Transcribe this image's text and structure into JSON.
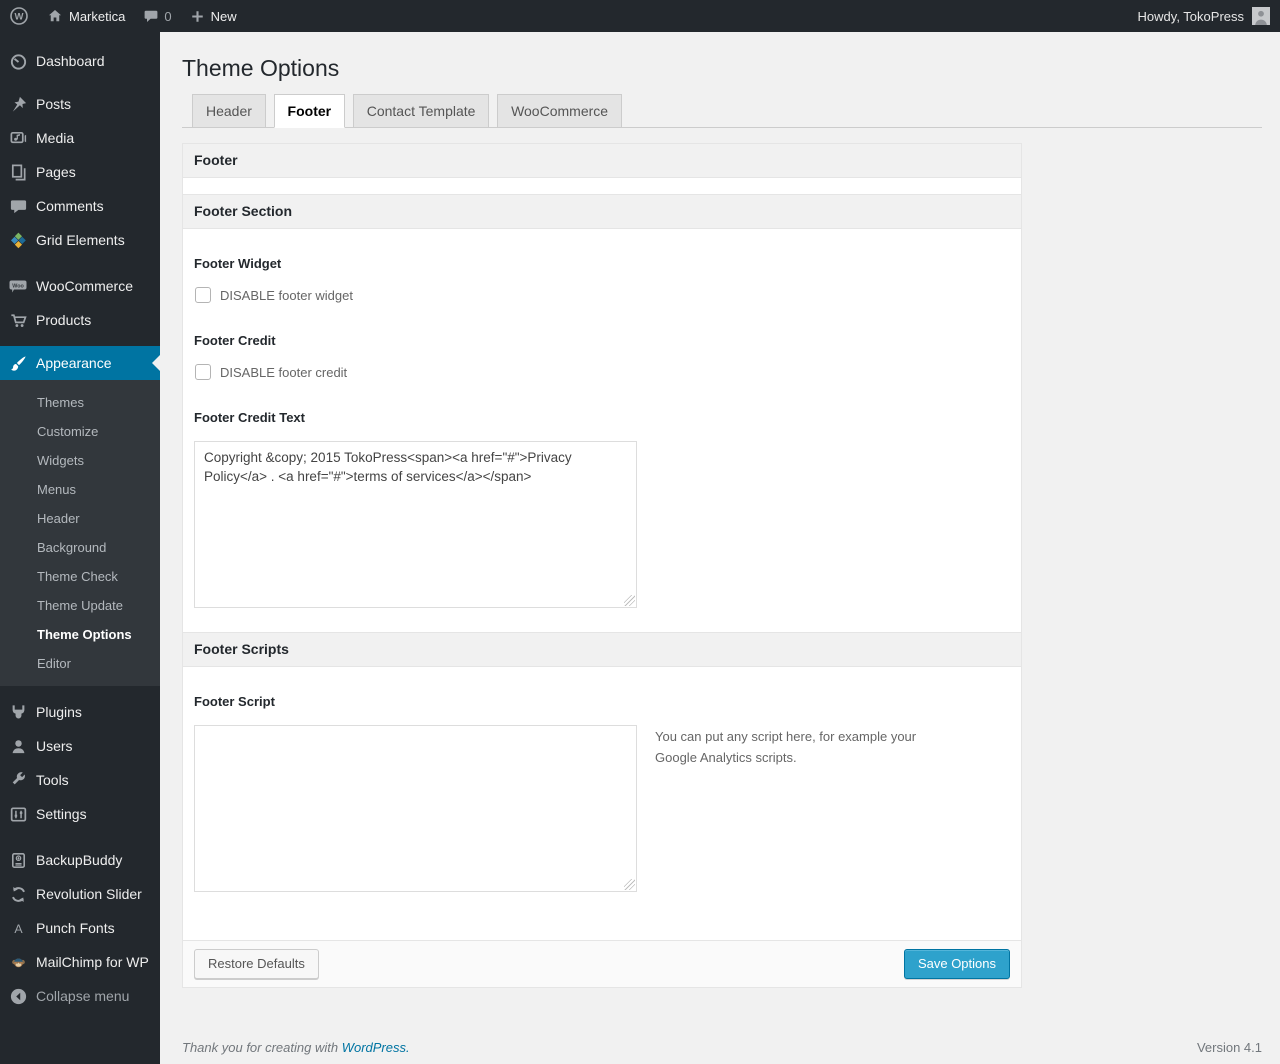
{
  "admin_bar": {
    "site_name": "Marketica",
    "comments_count": "0",
    "new_label": "New",
    "howdy": "Howdy, TokoPress"
  },
  "sidebar": {
    "items": [
      {
        "label": "Dashboard"
      },
      {
        "label": "Posts"
      },
      {
        "label": "Media"
      },
      {
        "label": "Pages"
      },
      {
        "label": "Comments"
      },
      {
        "label": "Grid Elements"
      },
      {
        "label": "WooCommerce"
      },
      {
        "label": "Products"
      },
      {
        "label": "Appearance"
      },
      {
        "label": "Plugins"
      },
      {
        "label": "Users"
      },
      {
        "label": "Tools"
      },
      {
        "label": "Settings"
      },
      {
        "label": "BackupBuddy"
      },
      {
        "label": "Revolution Slider"
      },
      {
        "label": "Punch Fonts"
      },
      {
        "label": "MailChimp for WP"
      },
      {
        "label": "Collapse menu"
      }
    ],
    "appearance_submenu": [
      "Themes",
      "Customize",
      "Widgets",
      "Menus",
      "Header",
      "Background",
      "Theme Check",
      "Theme Update",
      "Theme Options",
      "Editor"
    ],
    "current_submenu": "Theme Options"
  },
  "page": {
    "title": "Theme Options",
    "tabs": [
      {
        "label": "Header"
      },
      {
        "label": "Footer"
      },
      {
        "label": "Contact Template"
      },
      {
        "label": "WooCommerce"
      }
    ],
    "active_tab": "Footer"
  },
  "panel": {
    "box_title": "Footer",
    "section_title": "Footer Section",
    "scripts_title": "Footer Scripts",
    "fields": {
      "footer_widget": {
        "label": "Footer Widget",
        "checkbox_label": "DISABLE footer widget"
      },
      "footer_credit": {
        "label": "Footer Credit",
        "checkbox_label": "DISABLE footer credit"
      },
      "footer_credit_text": {
        "label": "Footer Credit Text",
        "value": "Copyright &copy; 2015 TokoPress<span><a href=\"#\">Privacy Policy</a> . <a href=\"#\">terms of services</a></span>"
      },
      "footer_script": {
        "label": "Footer Script",
        "value": "",
        "description": "You can put any script here, for example your Google Analytics scripts."
      }
    },
    "buttons": {
      "restore": "Restore Defaults",
      "save": "Save Options"
    }
  },
  "page_footer": {
    "thanks_prefix": "Thank you for creating with ",
    "thanks_link": "WordPress.",
    "version": "Version 4.1"
  },
  "colors": {
    "admin_accent": "#0074a2",
    "primary_button": "#2ea2cc",
    "sidebar_bg": "#23282d",
    "body_bg": "#f1f1f1"
  }
}
